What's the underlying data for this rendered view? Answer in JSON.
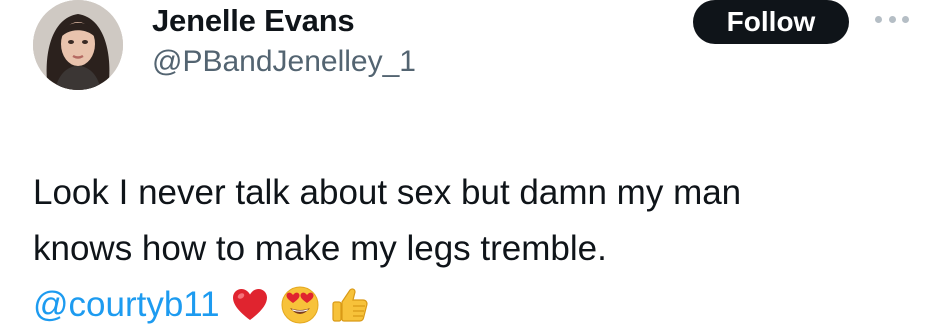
{
  "tweet": {
    "author": {
      "display_name": "Jenelle Evans",
      "handle": "@PBandJenelley_1"
    },
    "follow_label": "Follow",
    "text_lines": [
      "Look I never talk about sex but damn my man",
      "knows how to make my legs tremble."
    ],
    "mention": "@courtyb11",
    "emojis": [
      "red-heart-icon",
      "heart-eyes-face-icon",
      "thumbs-up-icon"
    ]
  }
}
